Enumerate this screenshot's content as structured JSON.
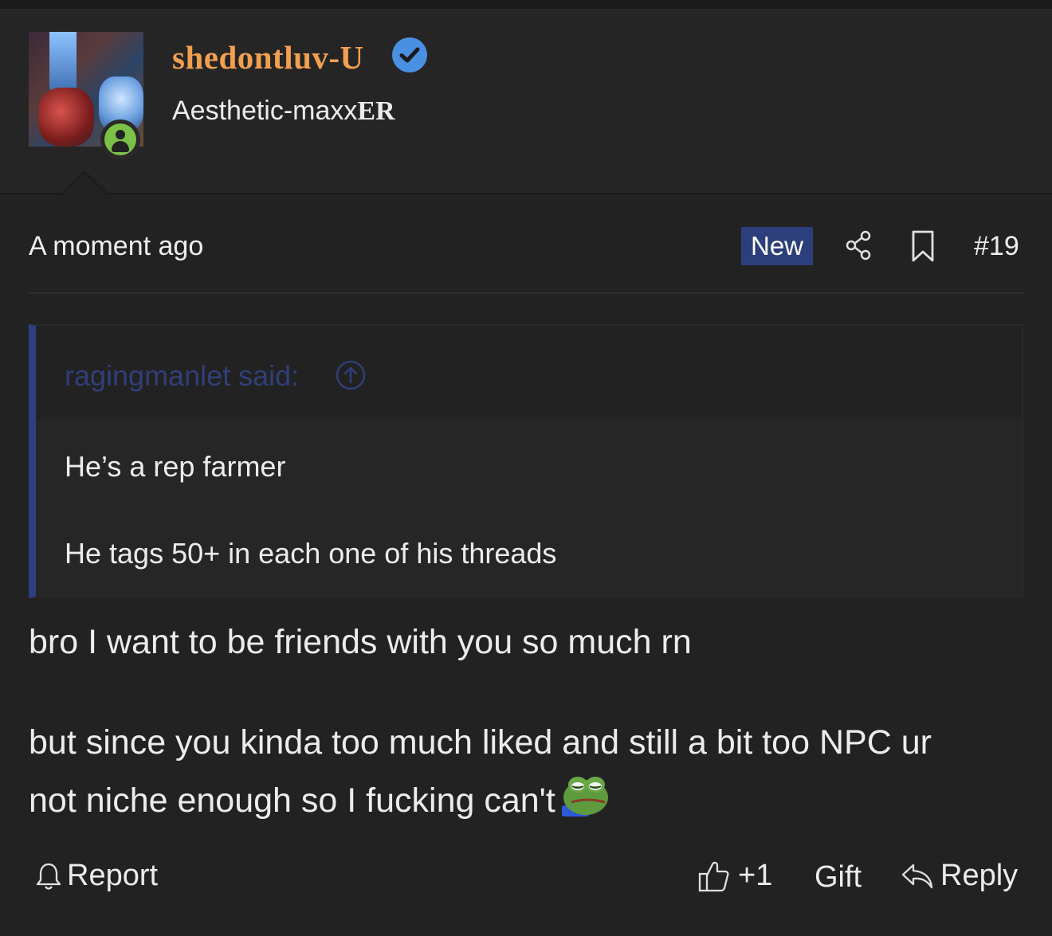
{
  "post": {
    "username": "shedontluv-U",
    "user_title_prefix": "Aesthetic-maxx",
    "user_title_suffix": "ER",
    "time": "A moment ago",
    "new_badge": "New",
    "post_number": "#19"
  },
  "quote": {
    "author": "ragingmanlet said:",
    "lines": [
      "He’s a rep farmer",
      "He tags 50+ in each one of his threads"
    ]
  },
  "message": {
    "line1": "bro I want to be friends with you so much rn",
    "line2": "but since you kinda too much liked and still a bit too NPC ur",
    "line3": "not niche enough so I fucking can't"
  },
  "actions": {
    "report": "Report",
    "like_count": "+1",
    "gift": "Gift",
    "reply": "Reply"
  },
  "icons": {
    "verified": "verified-badge-icon",
    "status": "online-user-icon",
    "share": "share-icon",
    "bookmark": "bookmark-icon",
    "quote_jump": "arrow-up-circle-icon",
    "report": "bell-icon",
    "like": "thumbs-up-icon",
    "reply": "reply-arrow-icon",
    "emoji": "pepe-emoji"
  },
  "colors": {
    "background": "#222222",
    "username": "#f0a050",
    "verified": "#4a90e2",
    "online": "#7cc147",
    "new_badge": "#2c3f7c",
    "quote_accent": "#2e3f80",
    "quote_author": "#313f78"
  }
}
